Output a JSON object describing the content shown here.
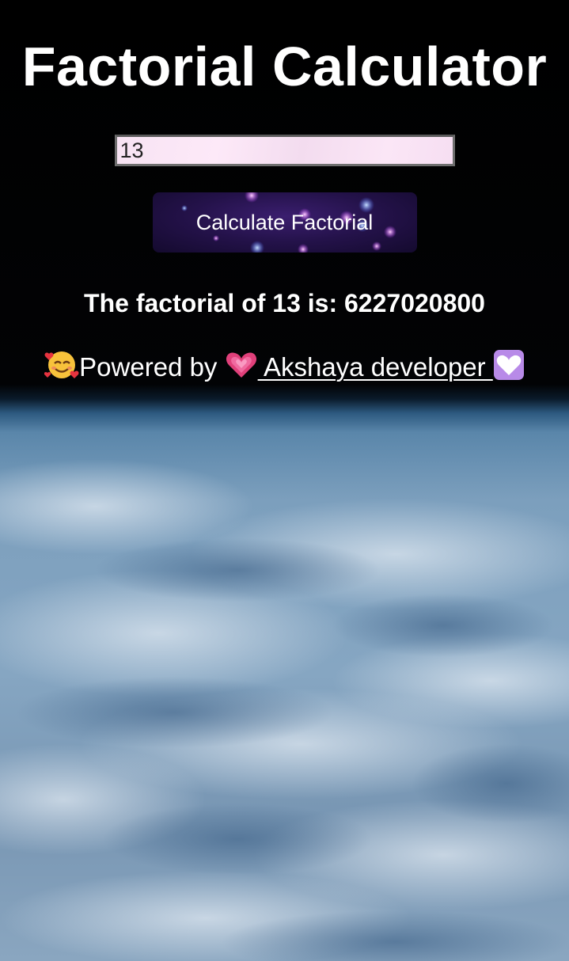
{
  "app": {
    "title": "Factorial Calculator"
  },
  "input": {
    "value": "13",
    "placeholder": ""
  },
  "button": {
    "label": "Calculate Factorial"
  },
  "result": {
    "text": "The factorial of 13 is: 6227020800"
  },
  "footer": {
    "prefix": "Powered by ",
    "link_text": " Akshaya developer ",
    "icons": [
      "smiling-face-with-hearts-icon",
      "growing-heart-icon",
      "white-heart-icon"
    ]
  }
}
